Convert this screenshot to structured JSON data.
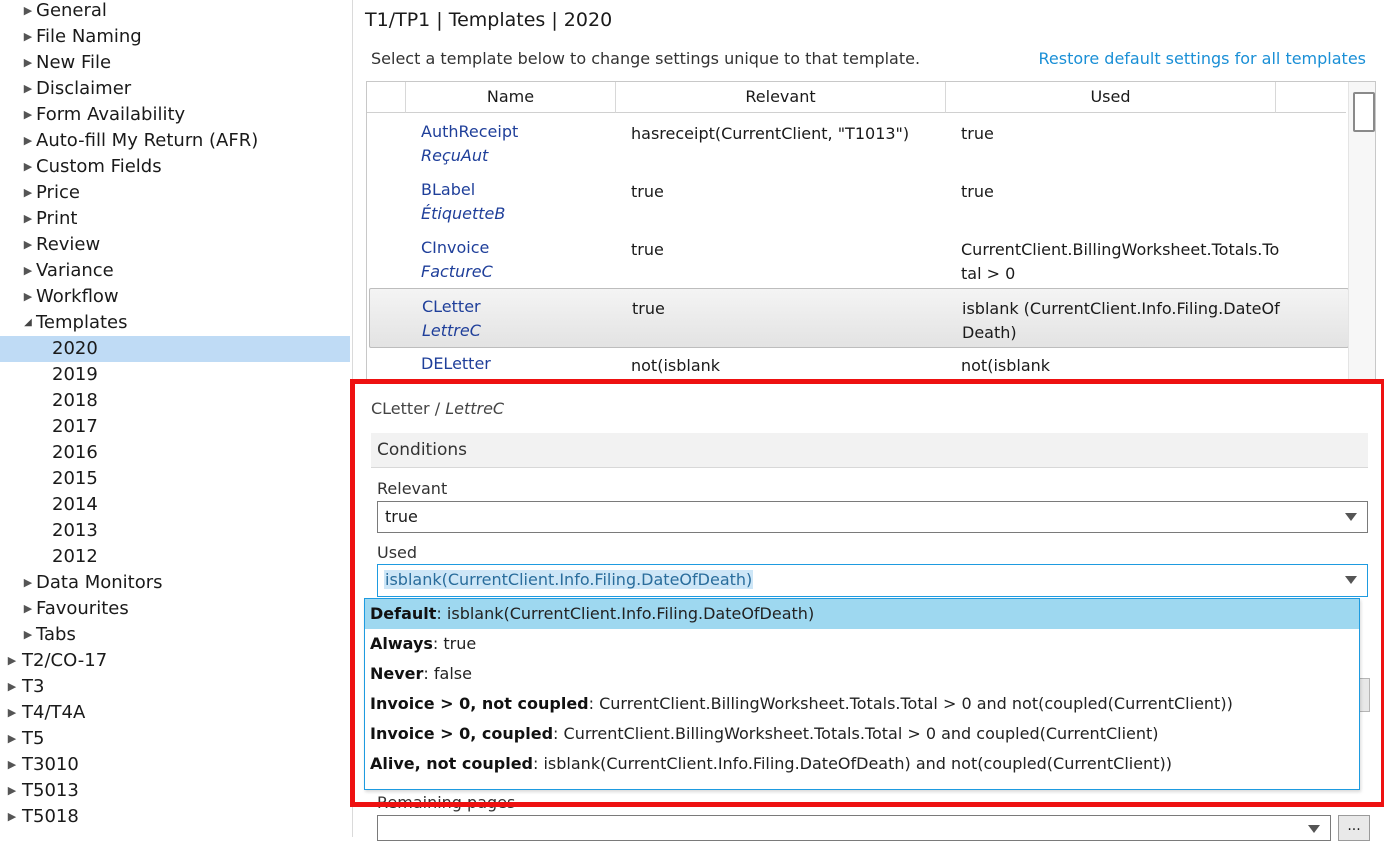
{
  "tree": {
    "items": [
      {
        "label": "General",
        "level": 1,
        "expander": "collapsed"
      },
      {
        "label": "File Naming",
        "level": 1,
        "expander": "collapsed"
      },
      {
        "label": "New File",
        "level": 1,
        "expander": "collapsed"
      },
      {
        "label": "Disclaimer",
        "level": 1,
        "expander": "collapsed"
      },
      {
        "label": "Form Availability",
        "level": 1,
        "expander": "collapsed"
      },
      {
        "label": "Auto-fill My Return (AFR)",
        "level": 1,
        "expander": "collapsed"
      },
      {
        "label": "Custom Fields",
        "level": 1,
        "expander": "collapsed"
      },
      {
        "label": "Price",
        "level": 1,
        "expander": "collapsed"
      },
      {
        "label": "Print",
        "level": 1,
        "expander": "collapsed"
      },
      {
        "label": "Review",
        "level": 1,
        "expander": "collapsed"
      },
      {
        "label": "Variance",
        "level": 1,
        "expander": "collapsed"
      },
      {
        "label": "Workflow",
        "level": 1,
        "expander": "collapsed"
      },
      {
        "label": "Templates",
        "level": 1,
        "expander": "expanded"
      },
      {
        "label": "2020",
        "level": 2,
        "expander": "none",
        "selected": true
      },
      {
        "label": "2019",
        "level": 2,
        "expander": "none"
      },
      {
        "label": "2018",
        "level": 2,
        "expander": "none"
      },
      {
        "label": "2017",
        "level": 2,
        "expander": "none"
      },
      {
        "label": "2016",
        "level": 2,
        "expander": "none"
      },
      {
        "label": "2015",
        "level": 2,
        "expander": "none"
      },
      {
        "label": "2014",
        "level": 2,
        "expander": "none"
      },
      {
        "label": "2013",
        "level": 2,
        "expander": "none"
      },
      {
        "label": "2012",
        "level": 2,
        "expander": "none"
      },
      {
        "label": "Data Monitors",
        "level": 1,
        "expander": "collapsed"
      },
      {
        "label": "Favourites",
        "level": 1,
        "expander": "collapsed"
      },
      {
        "label": "Tabs",
        "level": 1,
        "expander": "collapsed"
      },
      {
        "label": "T2/CO-17",
        "level": 0,
        "expander": "collapsed"
      },
      {
        "label": "T3",
        "level": 0,
        "expander": "collapsed"
      },
      {
        "label": "T4/T4A",
        "level": 0,
        "expander": "collapsed"
      },
      {
        "label": "T5",
        "level": 0,
        "expander": "collapsed"
      },
      {
        "label": "T3010",
        "level": 0,
        "expander": "collapsed"
      },
      {
        "label": "T5013",
        "level": 0,
        "expander": "collapsed"
      },
      {
        "label": "T5018",
        "level": 0,
        "expander": "collapsed"
      }
    ]
  },
  "header": {
    "title": "T1/TP1 | Templates | 2020",
    "subtitle": "Select a template below to change settings unique to that template.",
    "restore_link": "Restore default settings for all templates"
  },
  "grid": {
    "columns": [
      "Name",
      "Relevant",
      "Used"
    ],
    "rows": [
      {
        "name": "AuthReceipt",
        "name_fr": "ReçuAut",
        "relevant": "hasreceipt(CurrentClient, \"T1013\")",
        "used": "true",
        "selected": false
      },
      {
        "name": "BLabel",
        "name_fr": "ÉtiquetteB",
        "relevant": "true",
        "used": "true",
        "selected": false
      },
      {
        "name": "CInvoice",
        "name_fr": "FactureC",
        "relevant": "true",
        "used": "CurrentClient.BillingWorksheet.Totals.Total > 0",
        "selected": false
      },
      {
        "name": "CLetter",
        "name_fr": "LettreC",
        "relevant": "true",
        "used": "isblank (CurrentClient.Info.Filing.DateOfDeath)",
        "selected": true
      },
      {
        "name": "DELetter",
        "name_fr": "",
        "relevant": "not(isblank",
        "used": "not(isblank",
        "selected": false
      }
    ]
  },
  "detail": {
    "title_en": "CLetter",
    "title_sep": " / ",
    "title_fr": "LettreC",
    "section": "Conditions",
    "relevant_label": "Relevant",
    "relevant_value": "true",
    "used_label": "Used",
    "used_value": "isblank(CurrentClient.Info.Filing.DateOfDeath)",
    "remaining_label": "Remaining pages",
    "ellipsis": "..."
  },
  "dropdown": {
    "options": [
      {
        "key": "Default",
        "value": "isblank(CurrentClient.Info.Filing.DateOfDeath)",
        "highlighted": true
      },
      {
        "key": "Always",
        "value": "true",
        "highlighted": false
      },
      {
        "key": "Never",
        "value": "false",
        "highlighted": false
      },
      {
        "key": "Invoice > 0, not coupled",
        "value": "CurrentClient.BillingWorksheet.Totals.Total > 0 and not(coupled(CurrentClient))",
        "highlighted": false
      },
      {
        "key": "Invoice > 0, coupled",
        "value": "CurrentClient.BillingWorksheet.Totals.Total > 0 and coupled(CurrentClient)",
        "highlighted": false
      },
      {
        "key": "Alive, not coupled",
        "value": "isblank(CurrentClient.Info.Filing.DateOfDeath) and not(coupled(CurrentClient))",
        "highlighted": false
      }
    ]
  },
  "colors": {
    "highlight_border": "#ee1111",
    "tree_selected": "#bfdbf5",
    "option_highlight": "#9ed8f0",
    "link": "#1a8fd6",
    "template_name": "#1f3f9a"
  }
}
